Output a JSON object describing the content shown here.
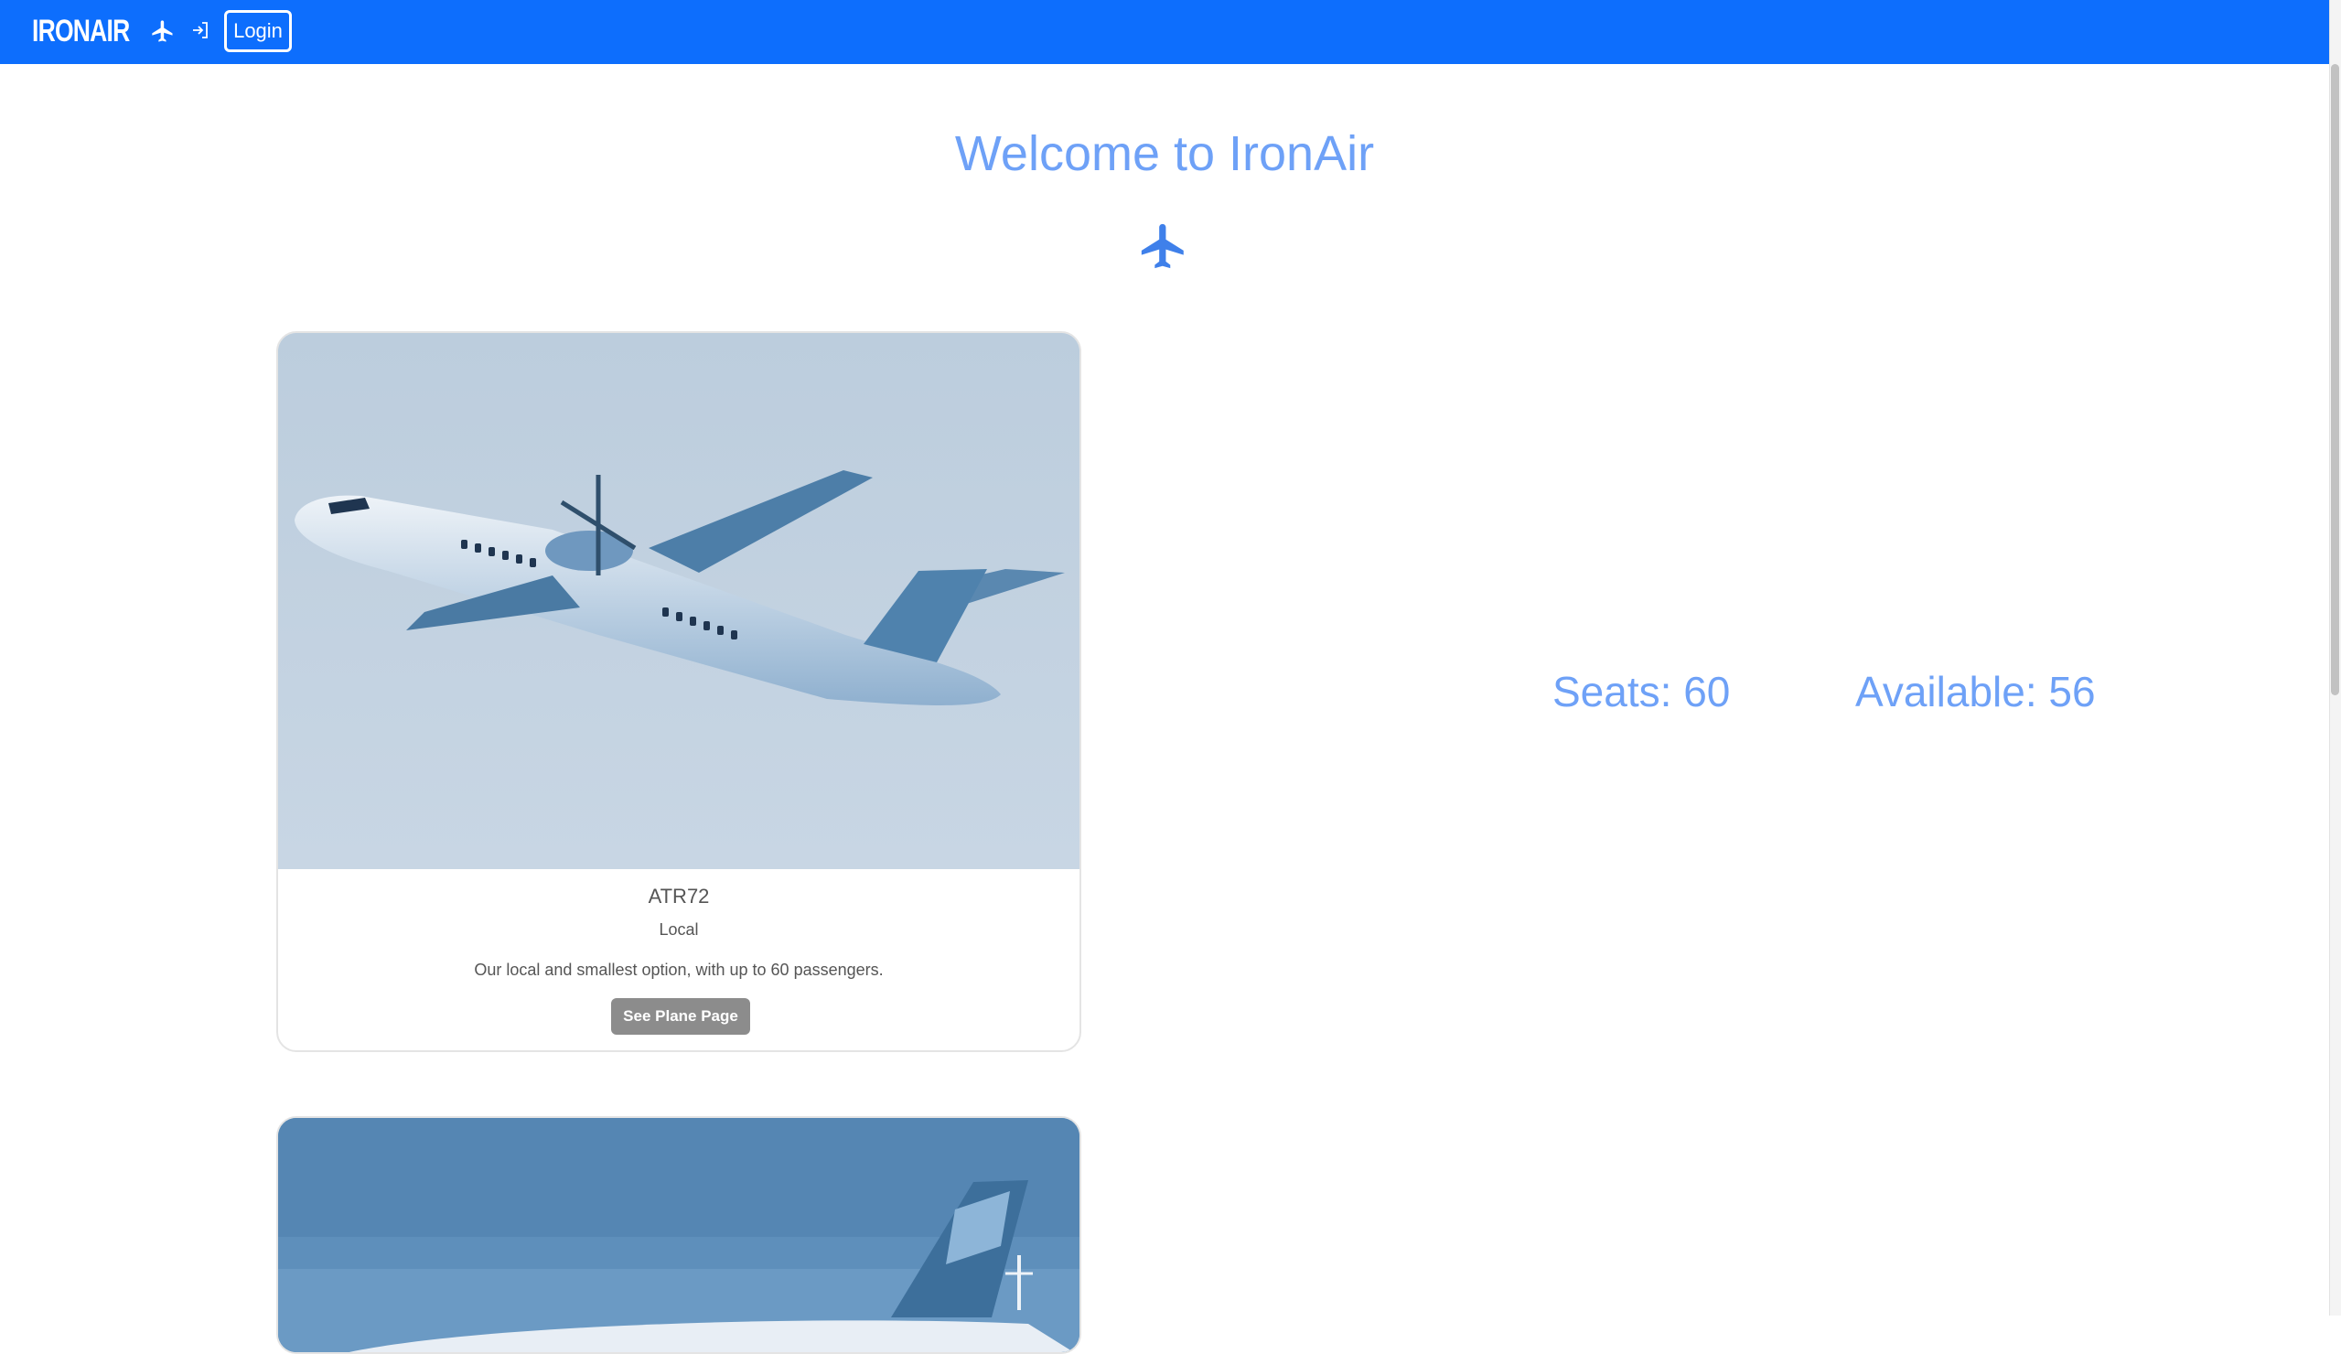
{
  "navbar": {
    "brand": "IRONAIR",
    "login_label": "Login",
    "icons": [
      "airplane-icon",
      "login-icon"
    ],
    "background_color": "#0d6efd"
  },
  "hero": {
    "title": "Welcome to IronAir",
    "icon": "airplane-icon",
    "accent_color": "#6ea1f7"
  },
  "planes": [
    {
      "image_icon": "airplane-photo",
      "name": "ATR72",
      "category": "Local",
      "description": "Our local and smallest option, with up to 60 passengers.",
      "button_label": "See Plane Page",
      "stats": {
        "seats": "Seats: 60",
        "available": "Available: 56"
      }
    },
    {
      "image_icon": "airplane-photo"
    }
  ]
}
